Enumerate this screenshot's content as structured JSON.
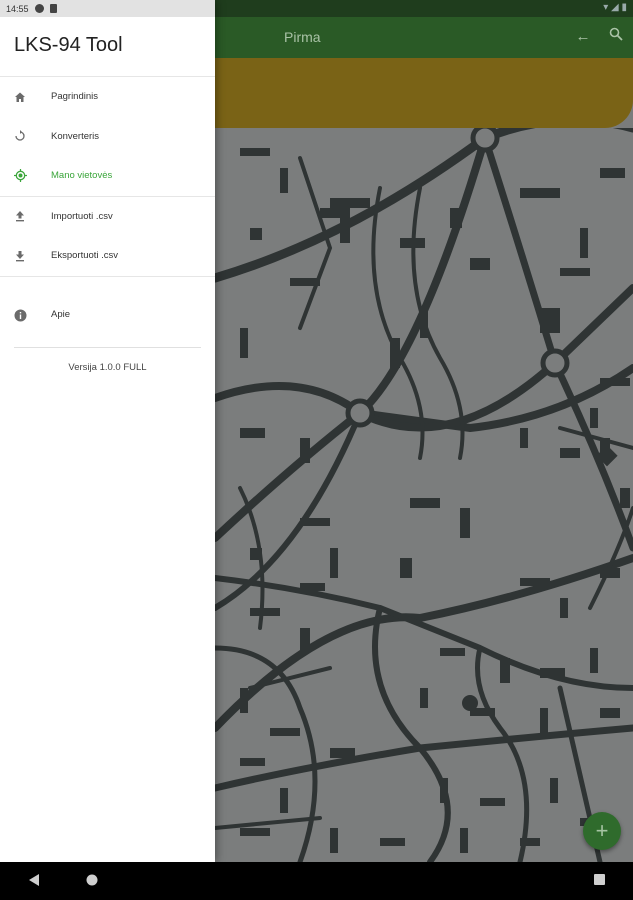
{
  "status": {
    "time": "14:55"
  },
  "toolbar": {
    "title": "Pirma"
  },
  "drawer": {
    "title": "LKS-94 Tool",
    "items": [
      {
        "label": "Pagrindinis",
        "icon": "home-icon"
      },
      {
        "label": "Konverteris",
        "icon": "refresh-icon"
      },
      {
        "label": "Mano vietovės",
        "icon": "location-target-icon",
        "active": true
      },
      {
        "label": "Importuoti .csv",
        "icon": "upload-icon"
      },
      {
        "label": "Eksportuoti .csv",
        "icon": "download-icon"
      },
      {
        "label": "Apie",
        "icon": "info-icon"
      }
    ],
    "version": "Versija 1.0.0 FULL"
  },
  "colors": {
    "accent": "#3aa53a",
    "toolbar": "#2a5a26",
    "banner": "#7a6316",
    "fab": "#2f6b2c"
  }
}
